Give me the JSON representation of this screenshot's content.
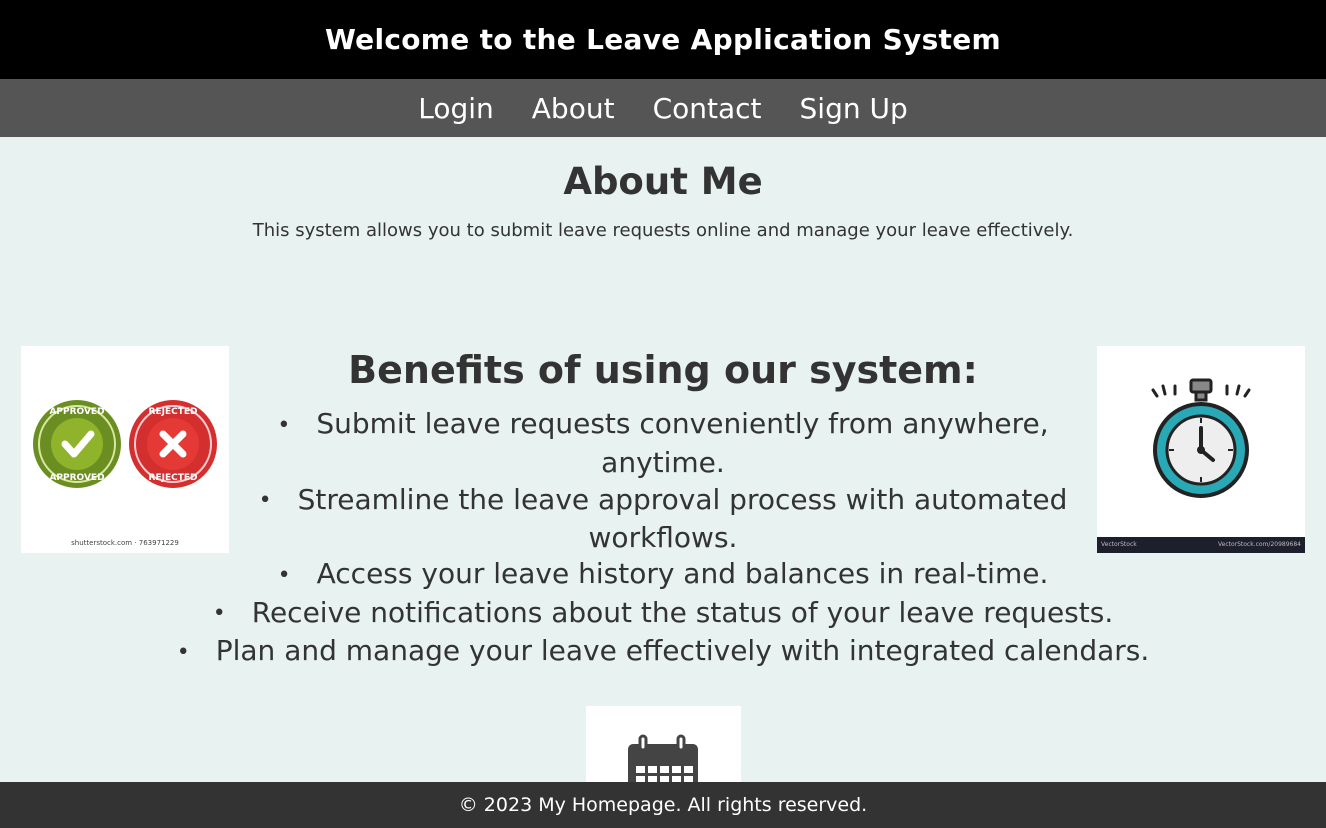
{
  "header": {
    "title": "Welcome to the Leave Application System"
  },
  "nav": {
    "items": [
      {
        "label": "Login"
      },
      {
        "label": "About"
      },
      {
        "label": "Contact"
      },
      {
        "label": "Sign Up"
      }
    ]
  },
  "about": {
    "title": "About Me",
    "text": "This system allows you to submit leave requests online and manage your leave effectively."
  },
  "benefits": {
    "title": "Benefits of using our system:",
    "items": [
      "Submit leave requests conveniently from anywhere, anytime.",
      "Streamline the leave approval process with automated workflows.",
      "Access your leave history and balances in real-time.",
      "Receive notifications about the status of your leave requests.",
      "Plan and manage your leave effectively with integrated calendars."
    ]
  },
  "images": {
    "left_caption": "shutterstock.com · 763971229",
    "left_approved": "APPROVED",
    "left_rejected": "REJECTED",
    "right_brand": "VectorStock",
    "right_id": "VectorStock.com/20989684"
  },
  "footer": {
    "text": "© 2023 My Homepage. All rights reserved."
  },
  "colors": {
    "header_bg": "#000000",
    "nav_bg": "#555555",
    "page_bg": "#e7f2f1",
    "footer_bg": "#333333"
  }
}
